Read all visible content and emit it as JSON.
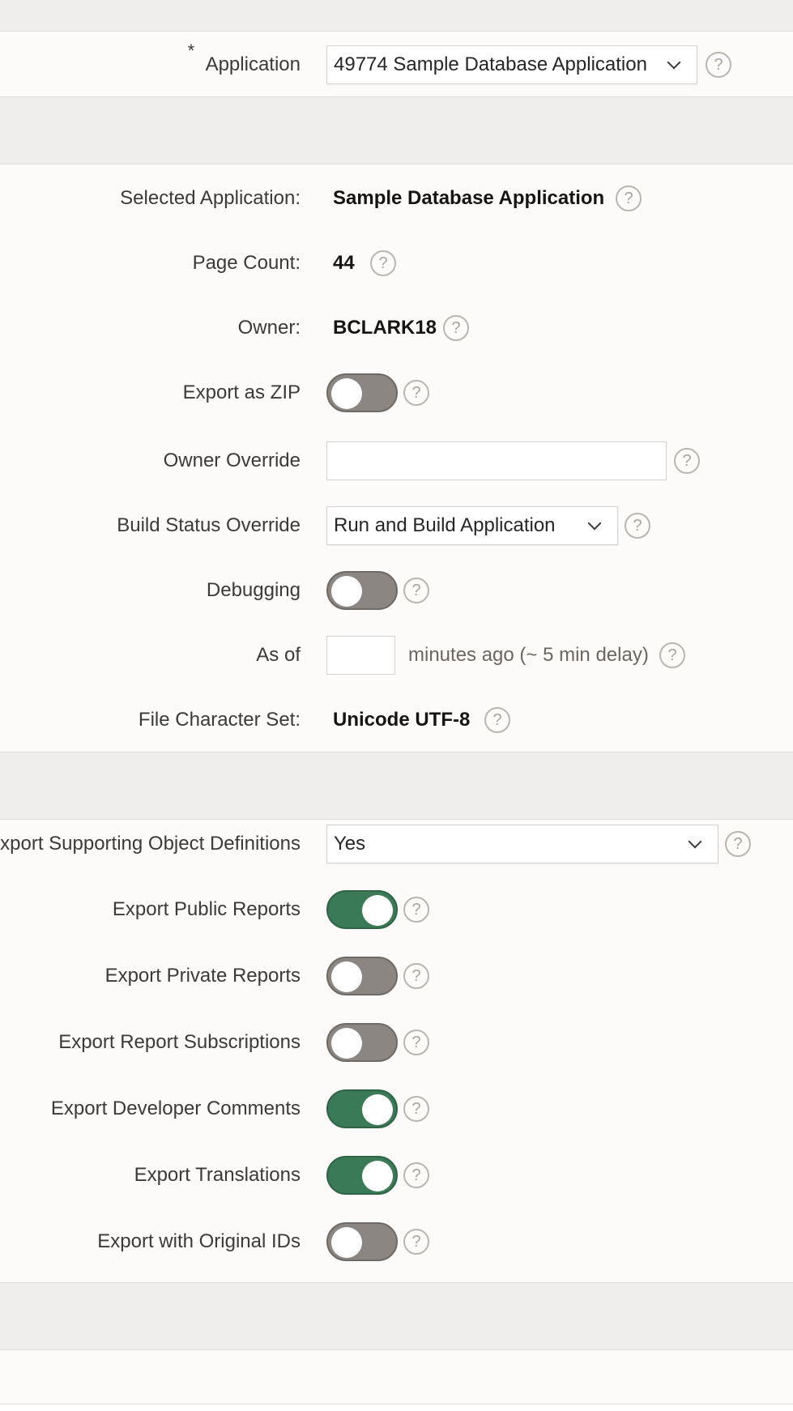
{
  "application": {
    "label": "Application",
    "required_mark": "*",
    "selected": "49774 Sample Database Application"
  },
  "details": {
    "selected_application_label": "Selected Application:",
    "selected_application_value": "Sample Database Application",
    "page_count_label": "Page Count:",
    "page_count_value": "44",
    "owner_label": "Owner:",
    "owner_value": "BCLARK18",
    "export_zip_label": "Export as ZIP",
    "export_zip_on": false,
    "owner_override_label": "Owner Override",
    "owner_override_value": "",
    "build_status_label": "Build Status Override",
    "build_status_value": "Run and Build Application",
    "debugging_label": "Debugging",
    "debugging_on": false,
    "as_of_label": "As of",
    "as_of_value": "",
    "as_of_suffix": "minutes ago (~ 5 min delay)",
    "charset_label": "File Character Set:",
    "charset_value": "Unicode UTF-8"
  },
  "export_options": {
    "supporting_objects_label": "Export Supporting Object Definitions",
    "supporting_objects_value": "Yes",
    "public_reports_label": "Export Public Reports",
    "public_reports_on": true,
    "private_reports_label": "Export Private Reports",
    "private_reports_on": false,
    "report_subscriptions_label": "Export Report Subscriptions",
    "report_subscriptions_on": false,
    "developer_comments_label": "Export Developer Comments",
    "developer_comments_on": true,
    "translations_label": "Export Translations",
    "translations_on": true,
    "original_ids_label": "Export with Original IDs",
    "original_ids_on": false
  },
  "help_glyph": "?",
  "colors": {
    "toggle_on": "#3b7a57",
    "toggle_off": "#8b8681",
    "band": "#efeeec",
    "panel": "#fcfbfa"
  }
}
